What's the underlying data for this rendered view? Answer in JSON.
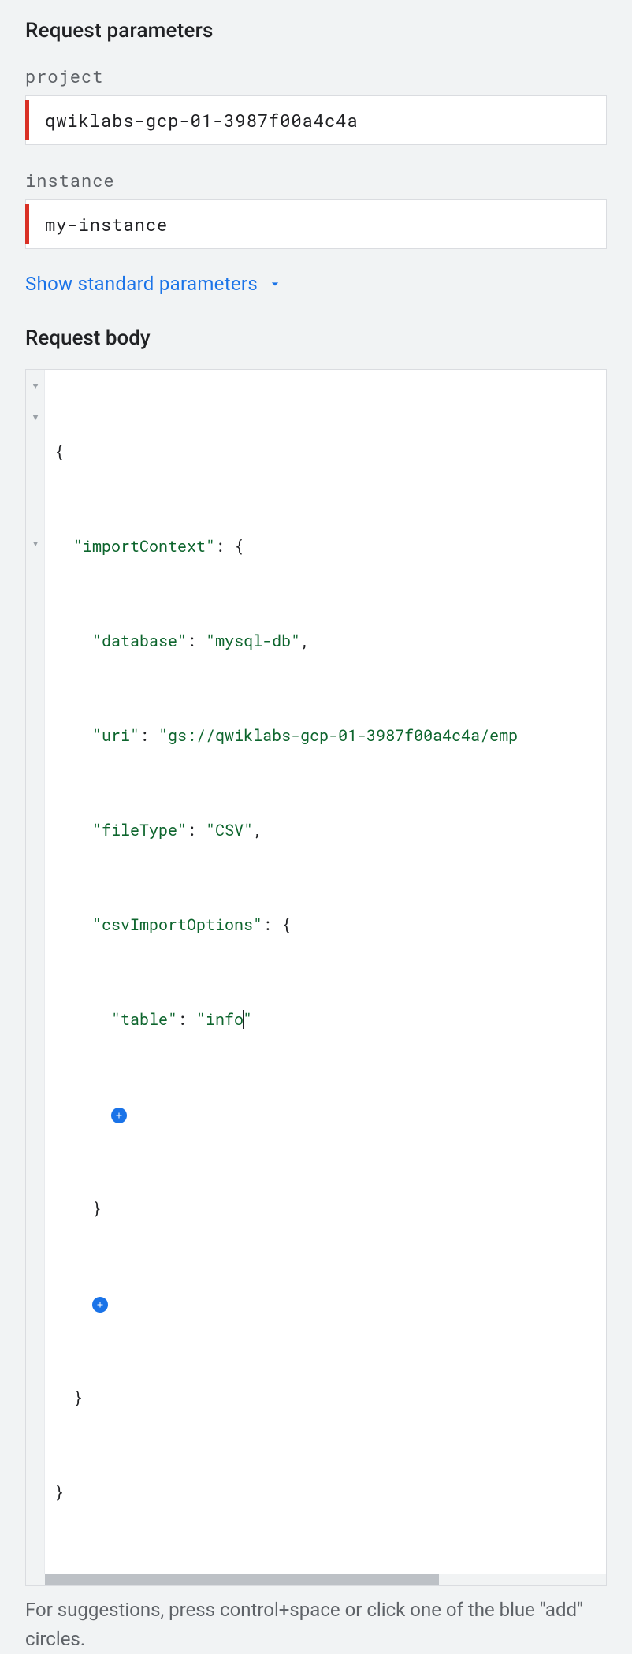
{
  "sections": {
    "parameters_title": "Request parameters",
    "body_title": "Request body"
  },
  "fields": {
    "project": {
      "label": "project",
      "value": "qwiklabs-gcp-01-3987f00a4c4a"
    },
    "instance": {
      "label": "instance",
      "value": "my-instance"
    }
  },
  "expand_link": "Show standard parameters",
  "json_body": {
    "importContext": {
      "database": "mysql-db",
      "uri": "gs://qwiklabs-gcp-01-3987f00a4c4a/emp",
      "fileType": "CSV",
      "csvImportOptions": {
        "table": "info"
      }
    }
  },
  "json_display": {
    "key_importContext": "\"importContext\"",
    "key_database": "\"database\"",
    "val_database": "\"mysql-db\"",
    "key_uri": "\"uri\"",
    "val_uri": "\"gs://qwiklabs-gcp-01-3987f00a4c4a/emp",
    "key_fileType": "\"fileType\"",
    "val_fileType": "\"CSV\"",
    "key_csvImportOptions": "\"csvImportOptions\"",
    "key_table": "\"table\"",
    "val_table_before": "\"info",
    "val_table_after": "\""
  },
  "hint": "For suggestions, press control+space or click one of the blue \"add\" circles."
}
